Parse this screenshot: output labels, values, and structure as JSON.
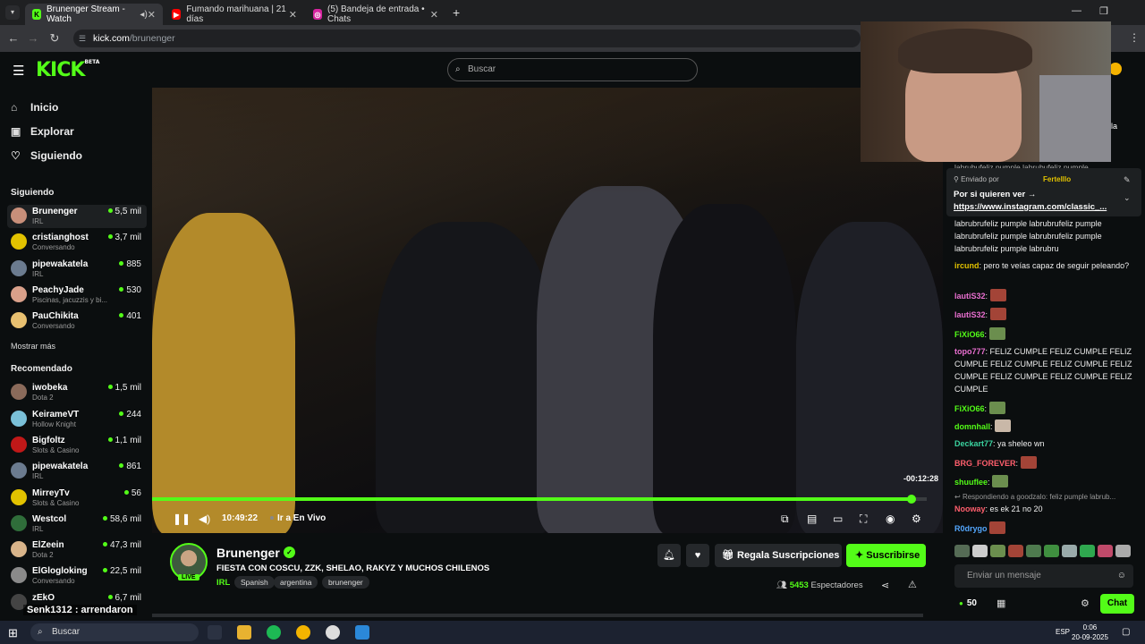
{
  "browser": {
    "tabs": [
      {
        "title": "Brunenger Stream - Watch",
        "favicon": "K",
        "favicon_color": "#53fc18",
        "active": true
      },
      {
        "title": "Fumando marihuana | 21 días",
        "favicon": "▶",
        "favicon_color": "#ff0000",
        "active": false
      },
      {
        "title": "(5) Bandeja de entrada • Chats",
        "favicon": "◎",
        "favicon_color": "#d6249f",
        "active": false
      }
    ],
    "url_host": "kick.com",
    "url_path": "/brunenger"
  },
  "header": {
    "logo": "KICK",
    "logo_badge": "BETA",
    "search_placeholder": "Buscar"
  },
  "sidebar": {
    "nav": [
      {
        "label": "Inicio",
        "icon": "home-icon"
      },
      {
        "label": "Explorar",
        "icon": "compass-icon"
      },
      {
        "label": "Siguiendo",
        "icon": "heart-icon"
      }
    ],
    "following_title": "Siguiendo",
    "following": [
      {
        "name": "Brunenger",
        "category": "IRL",
        "viewers": "5,5 mil",
        "color": "#c88f7a"
      },
      {
        "name": "cristianghost",
        "category": "Conversando",
        "viewers": "3,7 mil",
        "color": "#e2c200"
      },
      {
        "name": "pipewakatela",
        "category": "IRL",
        "viewers": "885",
        "color": "#6b7b8f"
      },
      {
        "name": "PeachyJade",
        "category": "Piscinas, jacuzzis y bi...",
        "viewers": "530",
        "color": "#d9a08a"
      },
      {
        "name": "PauChikita",
        "category": "Conversando",
        "viewers": "401",
        "color": "#e8c070"
      }
    ],
    "show_more": "Mostrar más",
    "recommended_title": "Recomendado",
    "recommended": [
      {
        "name": "iwobeka",
        "category": "Dota 2",
        "viewers": "1,5 mil",
        "color": "#8a6a5a"
      },
      {
        "name": "KeirameVT",
        "category": "Hollow Knight",
        "viewers": "244",
        "color": "#7ac0d8"
      },
      {
        "name": "Bigfoltz",
        "category": "Slots & Casino",
        "viewers": "1,1 mil",
        "color": "#c01818"
      },
      {
        "name": "pipewakatela",
        "category": "IRL",
        "viewers": "861",
        "color": "#6b7b8f"
      },
      {
        "name": "MirreyTv",
        "category": "Slots & Casino",
        "viewers": "56",
        "color": "#e2c200"
      },
      {
        "name": "Westcol",
        "category": "IRL",
        "viewers": "58,6 mil",
        "color": "#2f6d3a"
      },
      {
        "name": "ElZeein",
        "category": "Dota 2",
        "viewers": "47,3 mil",
        "color": "#d8b48a"
      },
      {
        "name": "ElGlogloking",
        "category": "Conversando",
        "viewers": "22,5 mil",
        "color": "#8a8a8a"
      },
      {
        "name": "zEkO",
        "category": "",
        "viewers": "6,7 mil",
        "color": "#444"
      }
    ]
  },
  "player": {
    "remaining": "-00:12:28",
    "time": "10:49:22",
    "go_live": "Ir a En Vivo",
    "progress": 0.98
  },
  "stream": {
    "streamer": "Brunenger",
    "live_badge": "LIVE",
    "title": "FIESTA CON COSCU, ZZK, SHELAO, RAKYZ Y MUCHOS CHILENOS",
    "category": "IRL",
    "tags": [
      "Spanish",
      "argentina",
      "brunenger"
    ],
    "gift_label": "Regala Suscripciones",
    "subscribe_label": "Suscribirse",
    "viewers_count": "5453",
    "viewers_label": "Espectadores"
  },
  "chat": {
    "pinned_label": "Enviado por",
    "pinned_user": "Fertelllo",
    "pinned_text": "Por si quieren ver →",
    "pinned_link": "https://www.instagram.com/classic_...",
    "top_text": "labrubufeliz pumple labrubufeliz pumple",
    "messages": [
      {
        "user": "",
        "text": "labrubrufeliz pumple labrubrufeliz pumple labrubrufeliz pumple labrubrufeliz pumple labrubrufeliz pumple labrubru",
        "color": "#fff"
      },
      {
        "user": "ircund",
        "text": ": pero te veías capaz de seguir peleando?",
        "color": "#e2c200"
      },
      {
        "user": "lautiS32",
        "text": ":",
        "color": "#e96fd0"
      },
      {
        "user": "lautiS32",
        "text": ":",
        "color": "#e96fd0"
      },
      {
        "user": "FiXiO66",
        "text": ":",
        "color": "#53fc18"
      },
      {
        "user": "topo777",
        "text": ": FELIZ CUMPLE FELIZ CUMPLE FELIZ CUMPLE FELIZ CUMPLE FELIZ CUMPLE FELIZ CUMPLE FELIZ CUMPLE FELIZ CUMPLE FELIZ CUMPLE",
        "color": "#e96fd0"
      },
      {
        "user": "FiXiO66",
        "text": ":",
        "color": "#53fc18"
      },
      {
        "user": "domnhall",
        "text": ":",
        "color": "#53fc18"
      },
      {
        "user": "Deckart77",
        "text": ": ya sheleo wn",
        "color": "#3ad4a0"
      },
      {
        "user": "BRG_FOREVER",
        "text": ":",
        "color": "#ff5f6d"
      },
      {
        "user": "shuuflee",
        "text": ":",
        "color": "#53fc18"
      }
    ],
    "reply_context": "Respondiendo a goodzalo: feliz pumple labrub...",
    "reply_user": "Nooway",
    "reply_text": ": es ek 21 no 20",
    "last_user": "R0drygo",
    "input_placeholder": "Enviar un mensaje",
    "points": "50",
    "chat_button": "Chat"
  },
  "overlay_text": "Senk1312 : arrendaron",
  "taskbar": {
    "search_placeholder": "Buscar",
    "lang": "ESP",
    "time": "0:06",
    "date": "20-09-2025"
  }
}
